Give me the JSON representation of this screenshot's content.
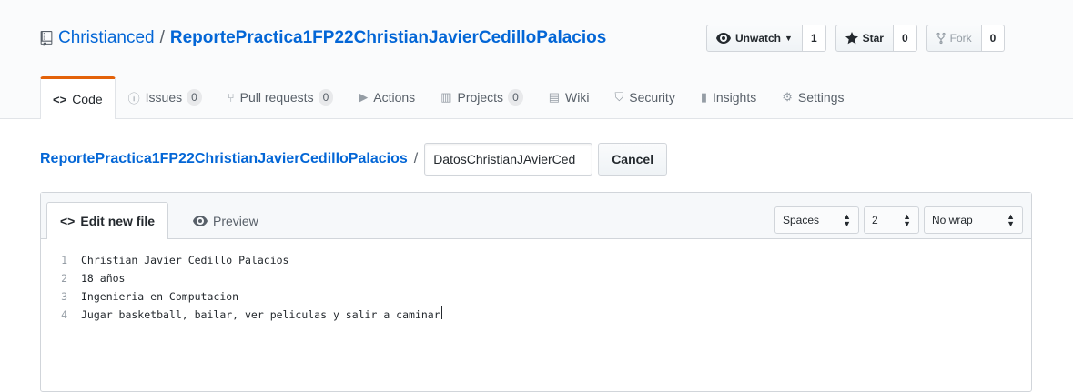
{
  "repo": {
    "owner": "Christianced",
    "separator": "/",
    "name": "ReportePractica1FP22ChristianJavierCedilloPalacios"
  },
  "actions": {
    "watch": {
      "label": "Unwatch",
      "count": "1"
    },
    "star": {
      "label": "Star",
      "count": "0"
    },
    "fork": {
      "label": "Fork",
      "count": "0"
    }
  },
  "tabs": [
    {
      "label": "Code"
    },
    {
      "label": "Issues",
      "count": "0"
    },
    {
      "label": "Pull requests",
      "count": "0"
    },
    {
      "label": "Actions"
    },
    {
      "label": "Projects",
      "count": "0"
    },
    {
      "label": "Wiki"
    },
    {
      "label": "Security"
    },
    {
      "label": "Insights"
    },
    {
      "label": "Settings"
    }
  ],
  "breadcrumb": {
    "repo_link": "ReportePractica1FP22ChristianJavierCedilloPalacios",
    "slash": "/",
    "filename_value": "DatosChristianJAvierCed",
    "cancel_label": "Cancel"
  },
  "editor": {
    "edit_tab": "Edit new file",
    "preview_tab": "Preview",
    "indent_mode": "Spaces",
    "indent_size": "2",
    "wrap_mode": "No wrap",
    "lines": [
      {
        "num": "1",
        "text": "Christian Javier Cedillo Palacios"
      },
      {
        "num": "2",
        "text": "18 años"
      },
      {
        "num": "3",
        "text": "Ingenieria en Computacion"
      },
      {
        "num": "4",
        "text": "Jugar basketball, bailar, ver peliculas y salir a caminar"
      }
    ]
  },
  "colors": {
    "link": "#0366d6",
    "tab_accent": "#e36209"
  }
}
